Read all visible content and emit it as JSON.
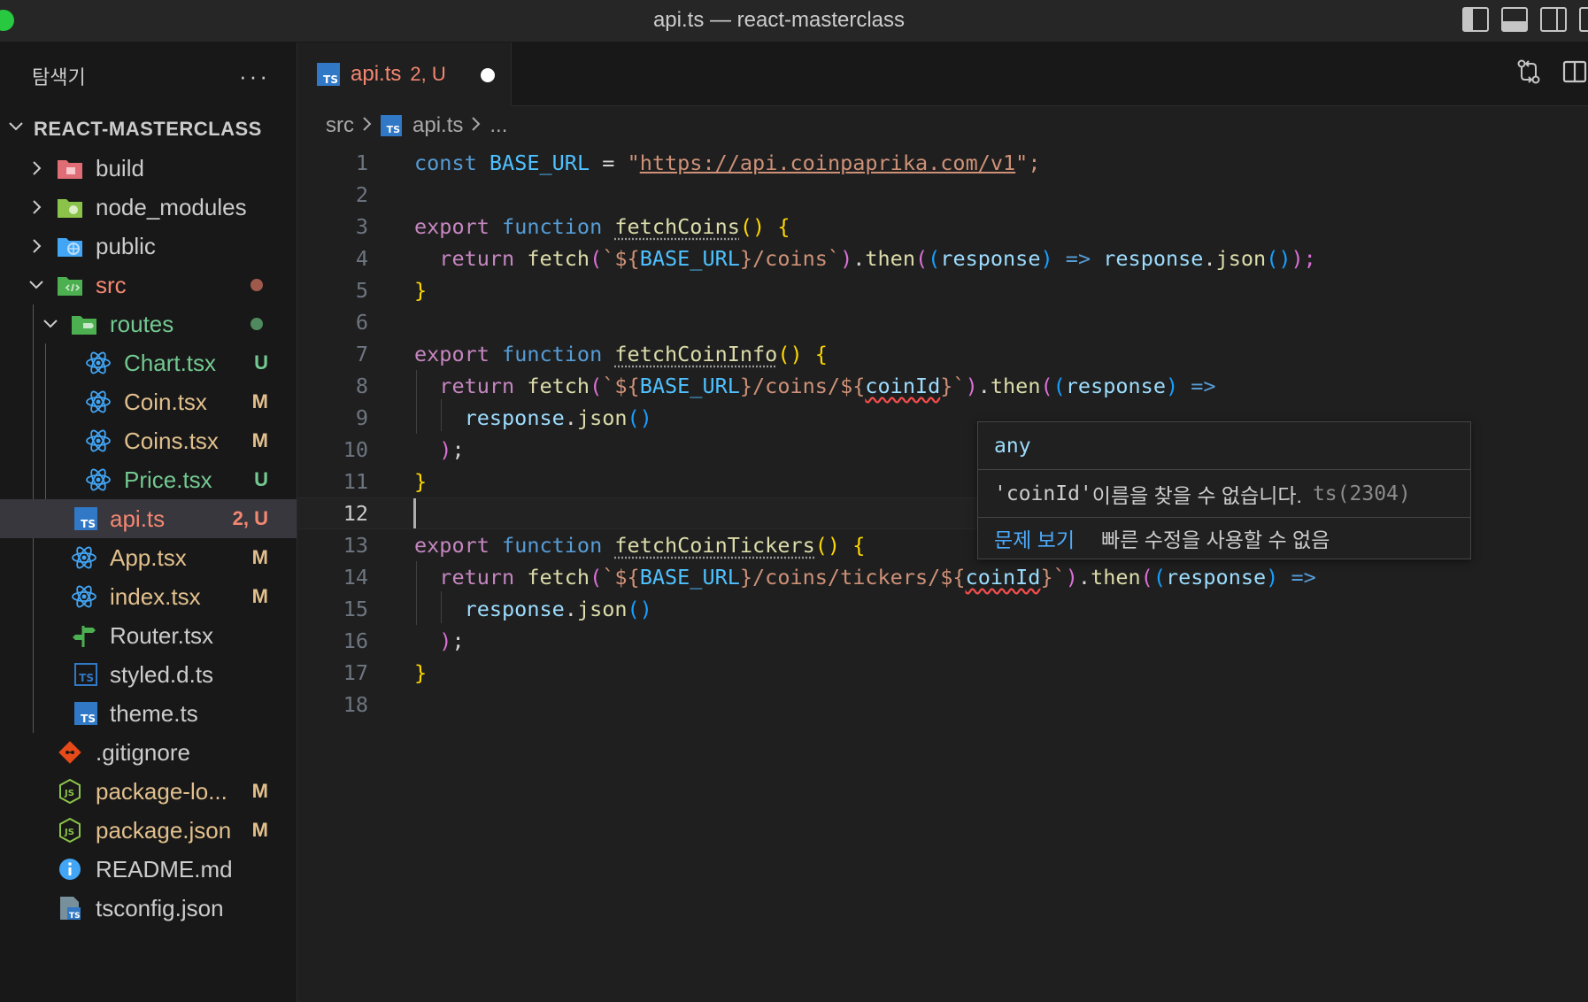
{
  "window": {
    "title": "api.ts — react-masterclass"
  },
  "sidebar": {
    "title": "탐색기",
    "more": "···",
    "project": "REACT-MASTERCLASS",
    "items": [
      {
        "name": "build",
        "kind": "folder",
        "icon": "folder-build-icon",
        "color": "#e06c75"
      },
      {
        "name": "node_modules",
        "kind": "folder",
        "icon": "folder-node-icon",
        "color": "#8bc34a"
      },
      {
        "name": "public",
        "kind": "folder",
        "icon": "folder-public-icon",
        "color": "#42a5f5"
      },
      {
        "name": "src",
        "kind": "folder-open",
        "icon": "folder-src-icon",
        "status": "modified-dot"
      },
      {
        "name": "routes",
        "kind": "folder-open",
        "icon": "folder-routes-icon",
        "status": "added-dot"
      },
      {
        "name": "Chart.tsx",
        "badge": "U"
      },
      {
        "name": "Coin.tsx",
        "badge": "M"
      },
      {
        "name": "Coins.tsx",
        "badge": "M"
      },
      {
        "name": "Price.tsx",
        "badge": "U"
      },
      {
        "name": "api.ts",
        "badge": "2, U"
      },
      {
        "name": "App.tsx",
        "badge": "M"
      },
      {
        "name": "index.tsx",
        "badge": "M"
      },
      {
        "name": "Router.tsx",
        "badge": ""
      },
      {
        "name": "styled.d.ts",
        "badge": ""
      },
      {
        "name": "theme.ts",
        "badge": ""
      },
      {
        "name": ".gitignore",
        "badge": ""
      },
      {
        "name": "package-lo...",
        "badge": "M"
      },
      {
        "name": "package.json",
        "badge": "M"
      },
      {
        "name": "README.md",
        "badge": ""
      },
      {
        "name": "tsconfig.json",
        "badge": ""
      }
    ]
  },
  "tab": {
    "icon_text": "TS",
    "label": "api.ts",
    "badge": "2, U"
  },
  "breadcrumb": {
    "folder": "src",
    "file": "api.ts",
    "more": "..."
  },
  "editor": {
    "line_numbers": [
      "1",
      "2",
      "3",
      "4",
      "5",
      "6",
      "7",
      "8",
      "9",
      "10",
      "11",
      "12",
      "13",
      "14",
      "15",
      "16",
      "17",
      "18"
    ],
    "current_line": 12,
    "code": {
      "l1": [
        "const",
        "BASE_URL",
        "=",
        "\"",
        "https://api.coinpaprika.com/v1",
        "\";"
      ],
      "l3": [
        "export",
        "function",
        "fetchCoins",
        "()",
        "{"
      ],
      "l4": [
        "return",
        "fetch",
        "(",
        "`${",
        "BASE_URL",
        "}/coins`",
        ")",
        ".",
        "then",
        "(",
        "(",
        "response",
        ")",
        "=>",
        "response",
        ".",
        "json",
        "()",
        ");"
      ],
      "l7": [
        "export",
        "function",
        "fetchCoinInfo",
        "()",
        "{"
      ],
      "l8": [
        "return",
        "fetch",
        "(",
        "`${",
        "BASE_URL",
        "}/coins/${",
        "coinId",
        "}`",
        ")",
        ".",
        "then",
        "(",
        "(",
        "response",
        ")",
        "=>"
      ],
      "l9": [
        "response",
        ".",
        "json",
        "()"
      ],
      "l10": [
        ")",
        ";"
      ],
      "l11": [
        "}"
      ],
      "l13": [
        "export",
        "function",
        "fetchCoinTickers",
        "()",
        "{"
      ],
      "l14": [
        "return",
        "fetch",
        "(",
        "`${",
        "BASE_URL",
        "}/coins/tickers/${",
        "coinId",
        "}`",
        ")",
        ".",
        "then",
        "(",
        "(",
        "response",
        ")",
        "=>"
      ],
      "l15": [
        "response",
        ".",
        "json",
        "()"
      ],
      "l16": [
        ")",
        ";"
      ],
      "l17": [
        "}"
      ]
    }
  },
  "hover": {
    "type": "any",
    "message_code": "'coinId'",
    "message_text": " 이름을 찾을 수 없습니다.",
    "error_code": "ts(2304)",
    "link": "문제 보기",
    "quickfix": "빠른 수정을 사용할 수 없음"
  }
}
